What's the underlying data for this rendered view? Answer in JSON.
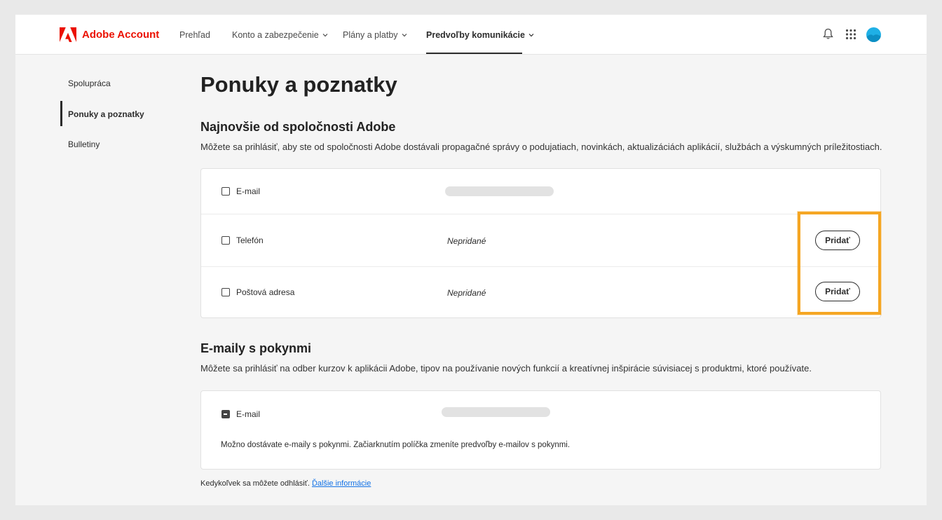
{
  "app": {
    "brand": "Adobe Account",
    "brand_color": "#eb1000"
  },
  "nav": {
    "items": [
      {
        "label": "Prehľad"
      },
      {
        "label": "Konto a zabezpečenie"
      },
      {
        "label": "Plány a platby"
      },
      {
        "label": "Predvoľby komunikácie",
        "active": true
      }
    ],
    "icons": [
      "bell-icon",
      "app-grid-icon",
      "avatar"
    ]
  },
  "sidebar": {
    "items": [
      {
        "label": "Spolupráca"
      },
      {
        "label": "Ponuky a poznatky",
        "active": true
      },
      {
        "label": "Bulletiny"
      }
    ]
  },
  "main": {
    "title": "Ponuky a poznatky",
    "offers": {
      "heading": "Najnovšie od spoločnosti Adobe",
      "description": "Môžete sa prihlásiť, aby ste od spoločnosti Adobe dostávali propagačné správy o podujatiach, novinkách, aktualizáciách aplikácií, službách a výskumných príležitostiach.",
      "rows": [
        {
          "label": "E-mail",
          "checked": false,
          "value_redacted": true
        },
        {
          "label": "Telefón",
          "checked": false,
          "status": "Nepridané",
          "button": "Pridať"
        },
        {
          "label": "Poštová adresa",
          "checked": false,
          "status": "Nepridané",
          "button": "Pridať"
        }
      ]
    },
    "instructional": {
      "heading": "E-maily s pokynmi",
      "description": "Môžete sa prihlásiť na odber kurzov k aplikácii Adobe, tipov na používanie nových funkcií a kreatívnej inšpirácie súvisiacej s produktmi, ktoré používate.",
      "row": {
        "label": "E-mail",
        "state": "indeterminate",
        "value_redacted": true
      },
      "note": "Možno dostávate e-maily s pokynmi. Začiarknutím políčka zmeníte predvoľby e-mailov s pokynmi."
    },
    "footer": {
      "text": "Kedykoľvek sa môžete odhlásiť.",
      "link": "Ďalšie informácie"
    }
  },
  "colors": {
    "highlight": "#f5a623",
    "link": "#1473e6",
    "avatar": "#1fb0e6"
  }
}
